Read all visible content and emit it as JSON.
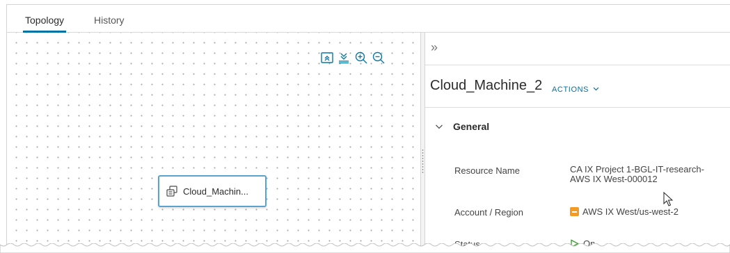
{
  "tabs": [
    {
      "label": "Topology",
      "active": true
    },
    {
      "label": "History",
      "active": false
    }
  ],
  "toolbar": {
    "icons": [
      "fit-to-view-icon",
      "download-icon",
      "zoom-in-icon",
      "zoom-out-icon"
    ]
  },
  "canvas": {
    "node": {
      "label": "Cloud_Machin...",
      "icon": "virtual-machine-icon"
    }
  },
  "panel": {
    "collapse_glyph": "»",
    "title": "Cloud_Machine_2",
    "actions_label": "ACTIONS",
    "section": {
      "label": "General",
      "properties": [
        {
          "label": "Resource Name",
          "value_line1": "CA IX Project 1-BGL-IT-research-",
          "value_line2": "AWS IX West-000012"
        },
        {
          "label": "Account / Region",
          "value": "AWS IX West/us-west-2",
          "icon": "aws-icon"
        },
        {
          "label": "Status",
          "value": "On",
          "icon": "play-icon"
        }
      ]
    }
  },
  "colors": {
    "accent": "#0072a3",
    "node_border": "#5aa2cf",
    "aws_orange": "#f29b26",
    "status_green": "#3c9b2f"
  }
}
